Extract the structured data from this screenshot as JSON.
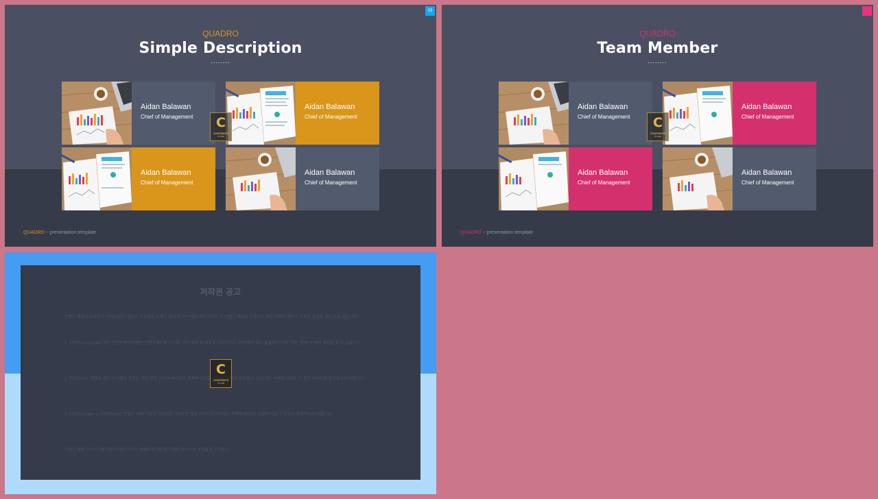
{
  "slides": [
    {
      "number": "03",
      "kicker": "QUADRO",
      "title": "Simple Description",
      "dots": "........",
      "accent": "#d9961a",
      "cards": [
        {
          "name": "Aidan Balawan",
          "role": "Chief of Management",
          "color": "#525a6e",
          "photo": "laptop-coffee"
        },
        {
          "name": "Aidan Balawan",
          "role": "Chief of Management",
          "color": "#d9961a",
          "photo": "documents"
        },
        {
          "name": "Aidan Balawan",
          "role": "Chief of Management",
          "color": "#d9961a",
          "photo": "documents"
        },
        {
          "name": "Aidan Balawan",
          "role": "Chief of Management",
          "color": "#525a6e",
          "photo": "laptop-coffee"
        }
      ],
      "footer_brand": "QUADRO",
      "footer_text": " ~ presentation template"
    },
    {
      "number": "",
      "kicker": "QUADRO",
      "title": "Team Member",
      "dots": "........",
      "accent": "#d4306e",
      "cards": [
        {
          "name": "Aidan Balawan",
          "role": "Chief of Management",
          "color": "#525a6e",
          "photo": "laptop-coffee"
        },
        {
          "name": "Aidan Balawan",
          "role": "Chief of Management",
          "color": "#d4306e",
          "photo": "documents"
        },
        {
          "name": "Aidan Balawan",
          "role": "Chief of Management",
          "color": "#d4306e",
          "photo": "documents"
        },
        {
          "name": "Aidan Balawan",
          "role": "Chief of Management",
          "color": "#525a6e",
          "photo": "laptop-coffee"
        }
      ],
      "footer_brand": "QUADRO",
      "footer_text": " ~ presentation template"
    }
  ],
  "notice": {
    "title": "저작권 공고",
    "paragraphs": [
      "콘텐츠 제품을 사용하기 전에 다음의 합의서 조항들을 자세히 읽어 주시기 바랍니다. 귀하가 본 콘텐츠 제품을 사용하는 것은 사용자 계약과 동등한 효력을 갖는 것을 말합니다.",
      "1. 저작권(Copyright): 모든 콘텐츠의 저작권은 콘텐츠웨어에 있으며, 무단 복제 및 배포를 금지합니다. 사전 동의 없이 불법적인 이용, 가공, 판매 시 법적 책임을 질 수 있습니다.",
      "2. 폰트(Font): 콘텐츠 제작 시 사용된 폰트는 해당 폰트 업체의 라이선스 정책에 따르며, 별도의 구매가 필요할 수 있습니다. 자세한 내용은 각 폰트 사이트를 참고하시기 바랍니다.",
      "3. 이미지(Image) & 아이콘(Icon): 콘텐츠 내에 사용된 이미지와 아이콘은 해당 사이트의 라이선스 정책에 따르며, 상업적 이용 시 반드시 확인하시기 바랍니다.",
      "콘텐츠 제품 라이선스에 대한 자세한 사항은 홈페이지 하단에 기재된 라이선스 규정을 참고하세요."
    ]
  },
  "logo": {
    "letter": "C",
    "line1": "CONTENTS",
    "line2": "STORE"
  }
}
